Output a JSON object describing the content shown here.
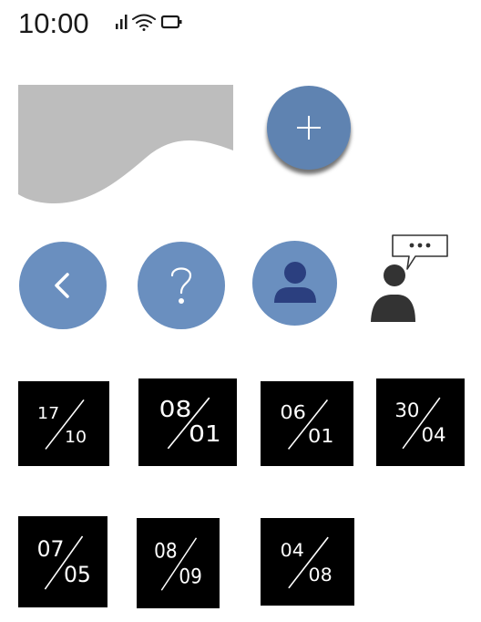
{
  "status_bar": {
    "time": "10:00",
    "icons": [
      "signal-icon",
      "wifi-icon",
      "battery-icon"
    ]
  },
  "fab": {
    "icon": "plus-icon",
    "color": "#5f83b1"
  },
  "action_buttons": [
    {
      "icon": "chevron-left-icon"
    },
    {
      "icon": "question-icon"
    },
    {
      "icon": "user-icon"
    },
    {
      "icon": "chat-user-icon"
    }
  ],
  "button_color": "#6a8fbf",
  "dates": [
    {
      "day": "17",
      "month": "10"
    },
    {
      "day": "08",
      "month": "01"
    },
    {
      "day": "06",
      "month": "01"
    },
    {
      "day": "30",
      "month": "04"
    },
    {
      "day": "07",
      "month": "05"
    },
    {
      "day": "08",
      "month": "09"
    },
    {
      "day": "04",
      "month": "08"
    }
  ]
}
